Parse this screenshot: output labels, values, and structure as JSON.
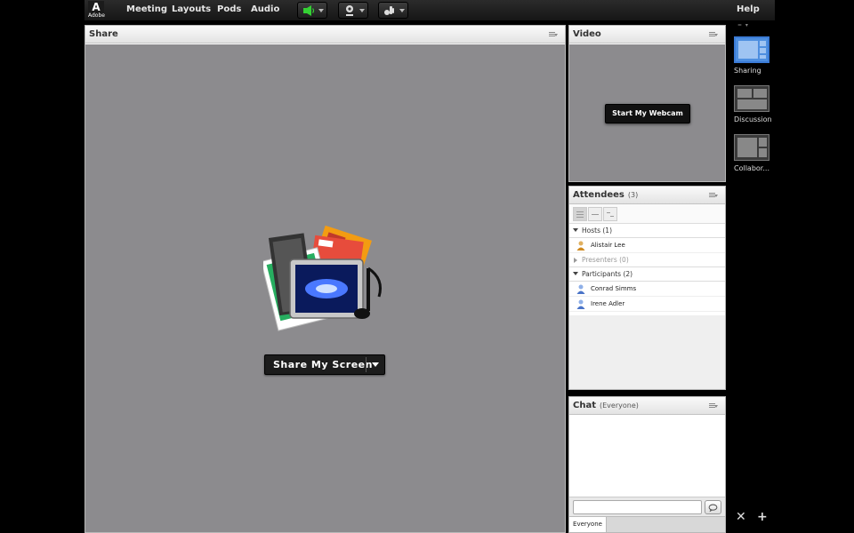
{
  "menubar": {
    "logo_text": "Adobe",
    "items": [
      "Meeting",
      "Layouts",
      "Pods",
      "Audio"
    ],
    "tools": [
      "speaker-icon",
      "webcam-icon",
      "raise-hand-icon"
    ],
    "help_label": "Help",
    "speaker_color": "#34d034"
  },
  "share_pod": {
    "title": "Share",
    "button_label": "Share My Screen"
  },
  "video_pod": {
    "title": "Video",
    "button_label": "Start My Webcam"
  },
  "attendees_pod": {
    "title": "Attendees",
    "count": "(3)",
    "sections": [
      {
        "label": "Hosts (1)",
        "members": [
          "Alistair Lee"
        ]
      },
      {
        "label": "Presenters (0)",
        "members": []
      },
      {
        "label": "Participants (2)",
        "members": [
          "Conrad Simms",
          "Irene Adler"
        ]
      }
    ]
  },
  "chat_pod": {
    "title": "Chat",
    "scope": "(Everyone)",
    "input_placeholder": "",
    "tab_label": "Everyone"
  },
  "layouts_rail": {
    "items": [
      {
        "label": "Sharing",
        "active": true
      },
      {
        "label": "Discussion",
        "active": false
      },
      {
        "label": "Collabor...",
        "active": false
      }
    ],
    "accent": "#3b7bd6"
  }
}
